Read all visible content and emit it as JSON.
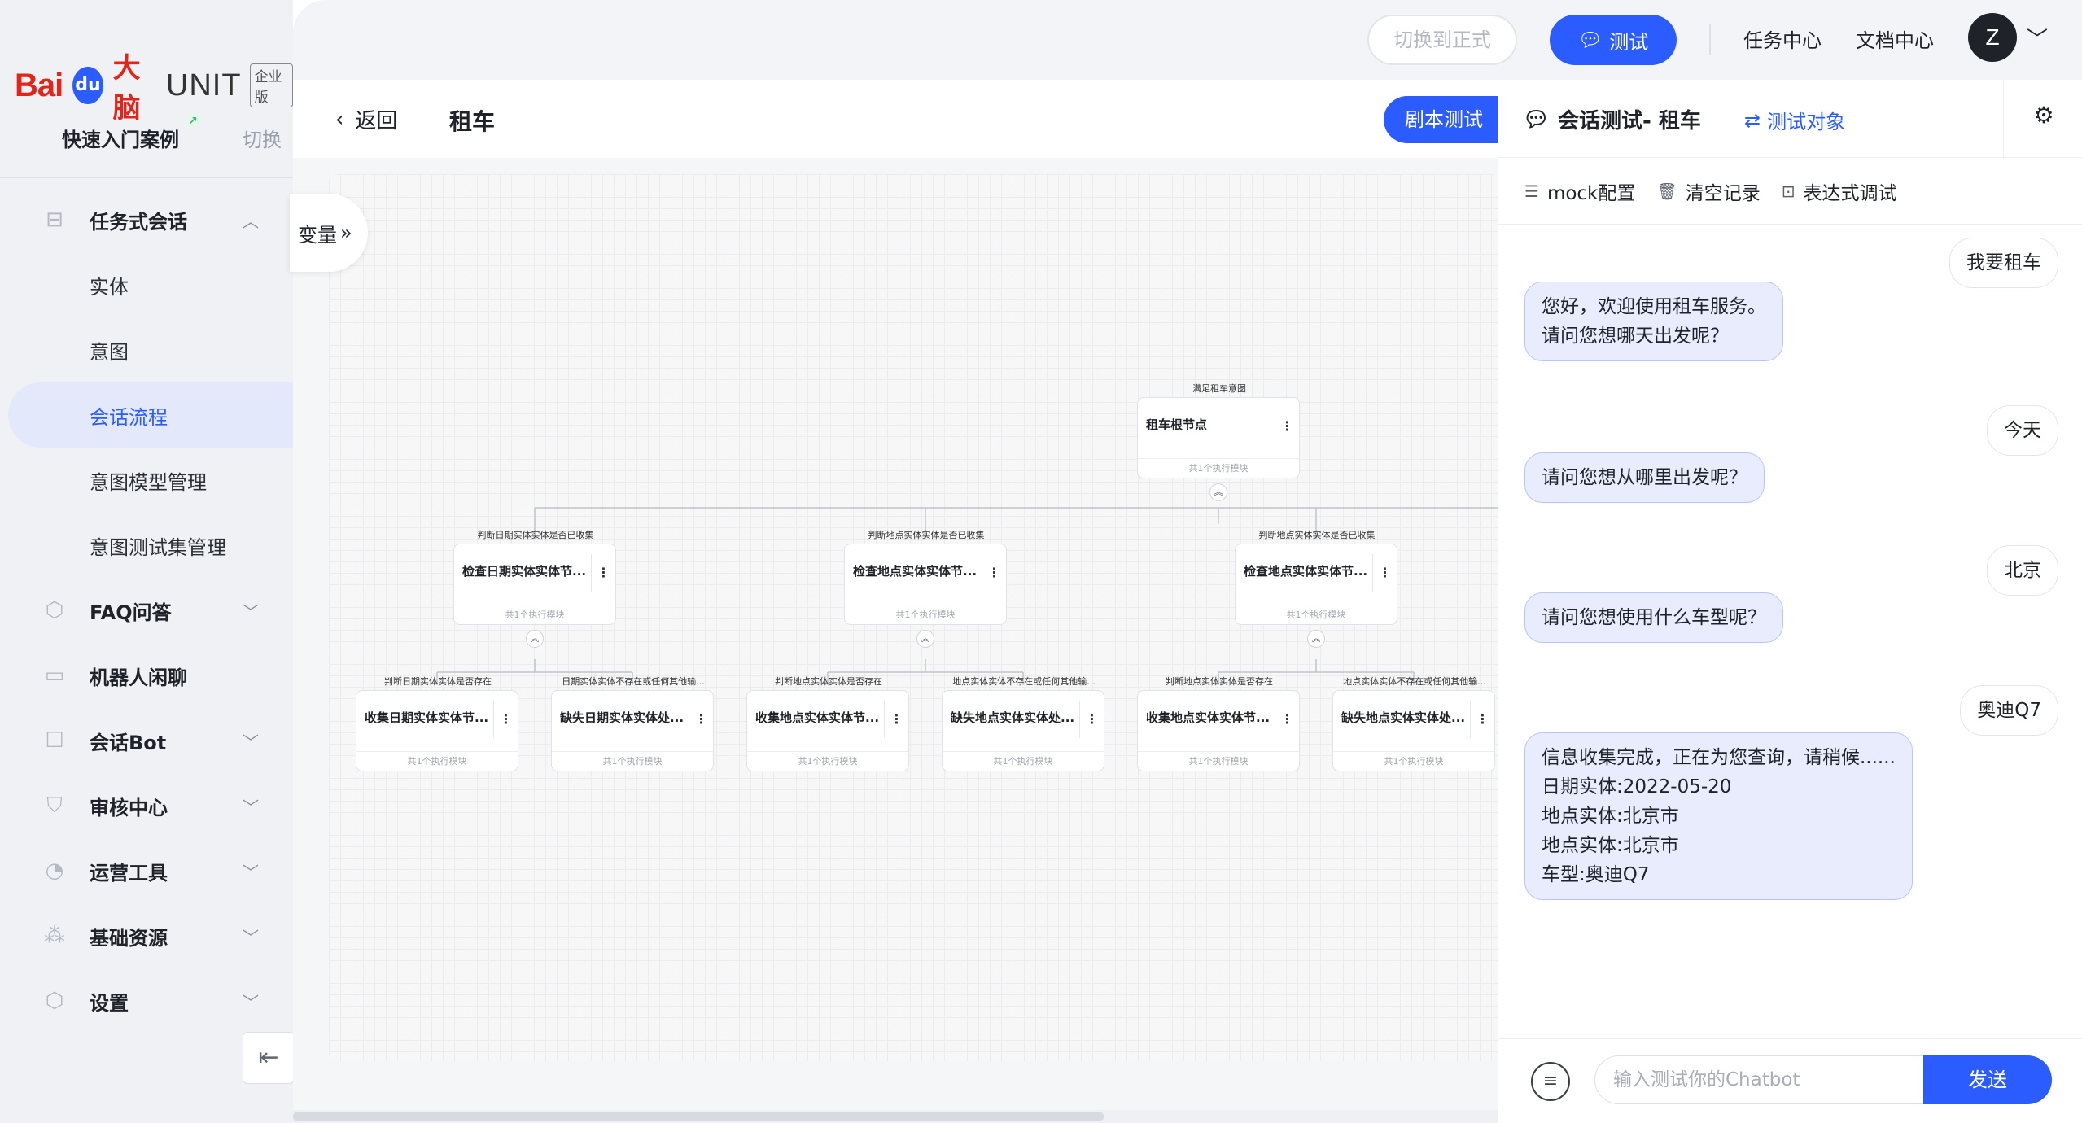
{
  "brand": {
    "baidu": "Bai",
    "paw": "du",
    "brain": "大脑",
    "unit": "UNIT",
    "badge": "企业版"
  },
  "quick": {
    "title": "快速入门案例",
    "switch": "切换"
  },
  "nav": {
    "task_dialog": "任务式会话",
    "sub_items": [
      "实体",
      "意图",
      "会话流程",
      "意图模型管理",
      "意图测试集管理"
    ],
    "faq": "FAQ问答",
    "chitchat": "机器人闲聊",
    "bot": "会话Bot",
    "audit": "审核中心",
    "ops": "运营工具",
    "resources": "基础资源",
    "settings": "设置"
  },
  "topbar": {
    "switch_formal": "切换到正式",
    "test": "测试",
    "task_center": "任务中心",
    "doc_center": "文档中心",
    "avatar": "Z"
  },
  "subheader": {
    "back": "返回",
    "title": "租车",
    "script_test": "剧本测试"
  },
  "canvas": {
    "variables": "变量",
    "root": {
      "cond": "满足租车意图",
      "title": "租车根节点",
      "foot": "共1个执行模块"
    },
    "level1": [
      {
        "cond": "判断日期实体实体是否已收集",
        "title": "检查日期实体实体节...",
        "foot": "共1个执行模块"
      },
      {
        "cond": "判断地点实体实体是否已收集",
        "title": "检查地点实体实体节...",
        "foot": "共1个执行模块"
      },
      {
        "cond": "判断地点实体实体是否已收集",
        "title": "检查地点实体实体节...",
        "foot": "共1个执行模块"
      }
    ],
    "level2": [
      {
        "cond": "判断日期实体实体是否存在",
        "title": "收集日期实体实体节...",
        "foot": "共1个执行模块"
      },
      {
        "cond": "日期实体实体不存在或任何其他输...",
        "title": "缺失日期实体实体处...",
        "foot": "共1个执行模块"
      },
      {
        "cond": "判断地点实体实体是否存在",
        "title": "收集地点实体实体节...",
        "foot": "共1个执行模块"
      },
      {
        "cond": "地点实体实体不存在或任何其他输...",
        "title": "缺失地点实体实体处...",
        "foot": "共1个执行模块"
      },
      {
        "cond": "判断地点实体实体是否存在",
        "title": "收集地点实体实体节...",
        "foot": "共1个执行模块"
      },
      {
        "cond": "地点实体实体不存在或任何其他输...",
        "title": "缺失地点实体实体处...",
        "foot": "共1个执行模块"
      }
    ]
  },
  "chat": {
    "title": "会话测试- 租车",
    "target": "测试对象",
    "tools": {
      "mock": "mock配置",
      "clear": "清空记录",
      "expr": "表达式调试"
    },
    "messages": [
      {
        "role": "user",
        "text": "我要租车"
      },
      {
        "role": "bot",
        "text": "您好，欢迎使用租车服务。\n请问您想哪天出发呢？"
      },
      {
        "role": "user",
        "text": "今天"
      },
      {
        "role": "bot",
        "text": "请问您想从哪里出发呢？"
      },
      {
        "role": "user",
        "text": "北京"
      },
      {
        "role": "bot",
        "text": "请问您想使用什么车型呢？"
      },
      {
        "role": "user",
        "text": "奥迪Q7"
      },
      {
        "role": "bot",
        "text": "信息收集完成，正在为您查询，请稍候......\n日期实体:2022-05-20\n地点实体:北京市\n地点实体:北京市\n车型:奥迪Q7"
      }
    ],
    "input_placeholder": "输入测试你的Chatbot",
    "send": "发送"
  }
}
